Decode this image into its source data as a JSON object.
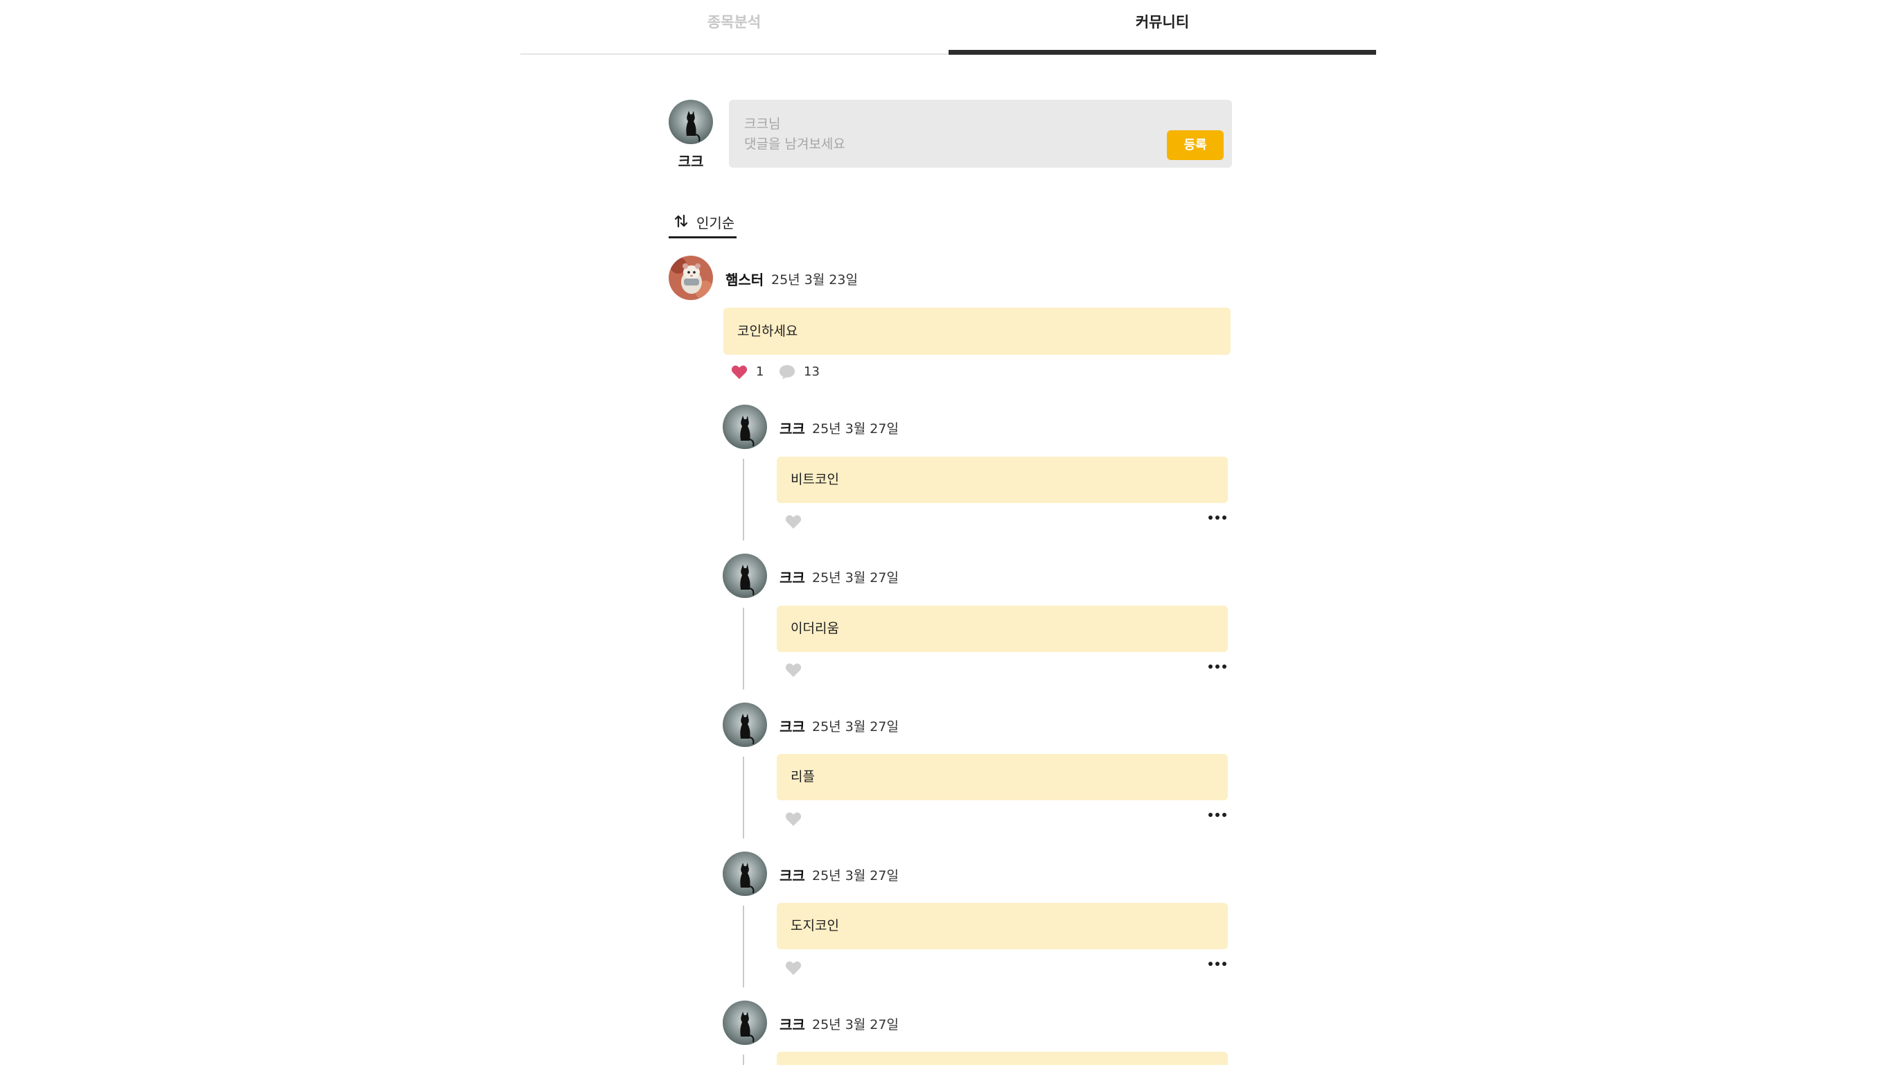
{
  "tabs": [
    {
      "label": "종목분석",
      "active": false
    },
    {
      "label": "커뮤니티",
      "active": true
    }
  ],
  "composer": {
    "avatar_icon": "black-cat-avatar-icon",
    "user_name": "크크",
    "user_label": "크크님",
    "placeholder": "댓글을 남겨보세요",
    "submit_label": "등록"
  },
  "sort": {
    "icon": "sort-arrows-icon",
    "label": "인기순"
  },
  "main_comment": {
    "avatar_icon": "hamster-avatar-icon",
    "author": "햄스터",
    "date": "25년 3월 23일",
    "text": "코인하세요",
    "likes": "1",
    "reply_count": "13",
    "liked": true
  },
  "replies": [
    {
      "author": "크크",
      "date": "25년 3월 27일",
      "text": "비트코인"
    },
    {
      "author": "크크",
      "date": "25년 3월 27일",
      "text": "이더리움"
    },
    {
      "author": "크크",
      "date": "25년 3월 27일",
      "text": "리플"
    },
    {
      "author": "크크",
      "date": "25년 3월 27일",
      "text": "도지코인"
    },
    {
      "author": "크크",
      "date": "25년 3월 27일",
      "text": ""
    }
  ],
  "colors": {
    "accent_button": "#f6b400",
    "bubble_bg": "#fdefc6",
    "liked_heart": "#d9496d",
    "unliked_heart": "#cfcfcf"
  }
}
